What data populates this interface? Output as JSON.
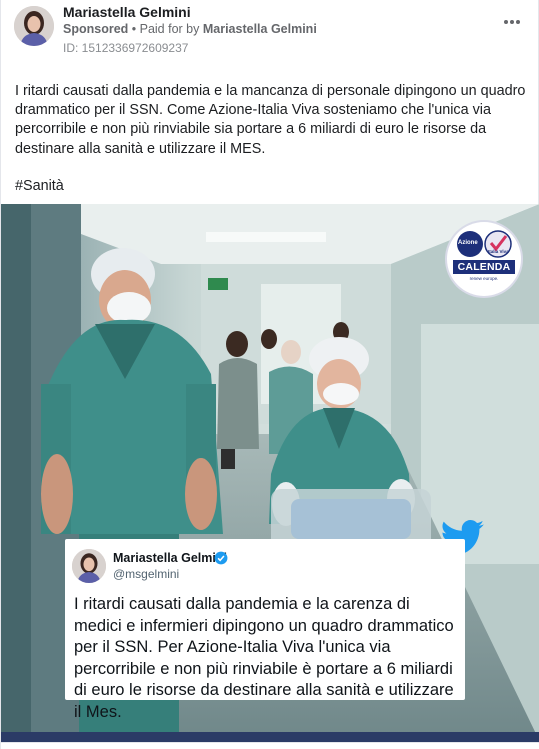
{
  "post": {
    "page_name": "Mariastella Gelmini",
    "sponsored_label": "Sponsored",
    "paid_prefix": " • Paid for by ",
    "funder": "Mariastella Gelmini",
    "ad_id": "ID: 1512336972609237",
    "body": "I ritardi causati dalla pandemia e la mancanza di personale dipingono un quadro drammatico per il SSN. Come Azione-Italia Viva sosteniamo che l'unica via percorribile e non più rinviabile sia portare a 6 miliardi di euro le risorse da destinare alla sanità e utilizzare il MES.",
    "hashtag": "#Sanità",
    "more_icon": "more-horizontal-icon"
  },
  "media": {
    "logo": {
      "brand_1": "Azione",
      "brand_2": "Italia Viva",
      "candidate": "CALENDA",
      "subtitle": "renew europe."
    },
    "tweet": {
      "name": "Mariastella Gelmini",
      "handle": "@msgelmini",
      "text": "I ritardi causati dalla pandemia e la carenza di medici e infermieri dipingono un quadro drammatico per il SSN. Per Azione-Italia Viva l'unica via percorribile e non più rinviabile è portare a 6 miliardi di euro le risorse da destinare alla sanità e utilizzare il Mes.",
      "verified_icon": "verified-badge-icon",
      "bird_icon": "twitter-bird-icon"
    },
    "colors": {
      "scrubs": "#3f8f8a",
      "wall": "#d9e4e2",
      "twitter_blue": "#1d9bf0",
      "calenda_blue": "#1d2f7a"
    }
  }
}
